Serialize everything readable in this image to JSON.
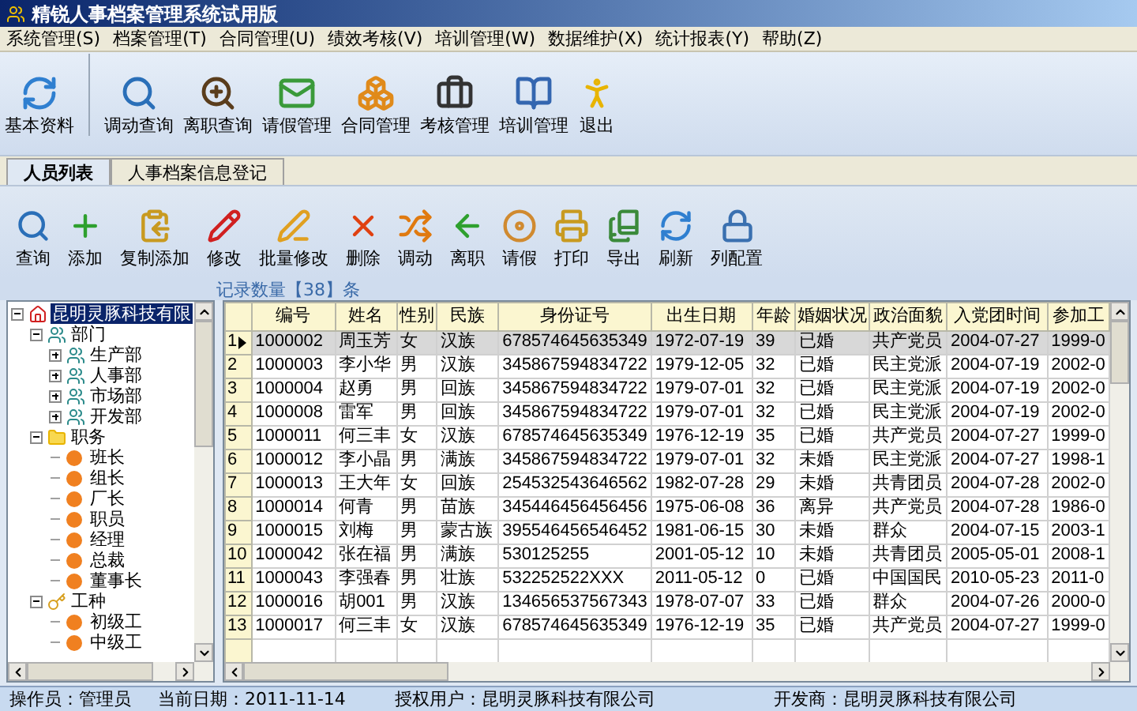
{
  "window": {
    "title": "精锐人事档案管理系统试用版"
  },
  "menu": [
    "系统管理(S)",
    "档案管理(T)",
    "合同管理(U)",
    "绩效考核(V)",
    "培训管理(W)",
    "数据维护(X)",
    "统计报表(Y)",
    "帮助(Z)"
  ],
  "main_toolbar": [
    {
      "label": "基本资料",
      "kind": "refresh"
    },
    {
      "label": "调动查询",
      "kind": "search"
    },
    {
      "label": "离职查询",
      "kind": "zoom"
    },
    {
      "label": "请假管理",
      "kind": "mail"
    },
    {
      "label": "合同管理",
      "kind": "boxes"
    },
    {
      "label": "考核管理",
      "kind": "case"
    },
    {
      "label": "培训管理",
      "kind": "books"
    },
    {
      "label": "退出",
      "kind": "exit"
    }
  ],
  "tabs": [
    {
      "label": "人员列表",
      "selected": true
    },
    {
      "label": "人事档案信息登记",
      "selected": false
    }
  ],
  "list_toolbar": [
    {
      "label": "查询",
      "kind": "search"
    },
    {
      "label": "添加",
      "kind": "plus"
    },
    {
      "label": "复制添加",
      "kind": "copy"
    },
    {
      "label": "修改",
      "kind": "pencil"
    },
    {
      "label": "批量修改",
      "kind": "pen"
    },
    {
      "label": "删除",
      "kind": "delete"
    },
    {
      "label": "调动",
      "kind": "move"
    },
    {
      "label": "离职",
      "kind": "back"
    },
    {
      "label": "请假",
      "kind": "disc"
    },
    {
      "label": "打印",
      "kind": "print"
    },
    {
      "label": "导出",
      "kind": "export"
    },
    {
      "label": "刷新",
      "kind": "refresh"
    },
    {
      "label": "列配置",
      "kind": "lock"
    }
  ],
  "record_count": "记录数量【38】条",
  "tree": [
    {
      "label": "昆明灵豚科技有限",
      "kind": "company",
      "expanded": true,
      "selected": true,
      "children": [
        {
          "label": "部门",
          "kind": "group",
          "expanded": true,
          "selected": false,
          "children": [
            {
              "label": "生产部",
              "kind": "dept",
              "expanded": false,
              "selected": false
            },
            {
              "label": "人事部",
              "kind": "dept",
              "expanded": false,
              "selected": false
            },
            {
              "label": "市场部",
              "kind": "dept",
              "expanded": false,
              "selected": false
            },
            {
              "label": "开发部",
              "kind": "dept",
              "expanded": false,
              "selected": false
            }
          ]
        },
        {
          "label": "职务",
          "kind": "folder",
          "expanded": true,
          "selected": false,
          "children": [
            {
              "label": "班长",
              "kind": "item",
              "selected": false
            },
            {
              "label": "组长",
              "kind": "item",
              "selected": false
            },
            {
              "label": "厂长",
              "kind": "item",
              "selected": false
            },
            {
              "label": "职员",
              "kind": "item",
              "selected": false
            },
            {
              "label": "经理",
              "kind": "item",
              "selected": false
            },
            {
              "label": "总裁",
              "kind": "item",
              "selected": false
            },
            {
              "label": "董事长",
              "kind": "item",
              "selected": false
            }
          ]
        },
        {
          "label": "工种",
          "kind": "key",
          "expanded": true,
          "selected": false,
          "children": [
            {
              "label": "初级工",
              "kind": "item",
              "selected": false
            },
            {
              "label": "中级工",
              "kind": "item",
              "selected": false
            }
          ]
        }
      ]
    }
  ],
  "table": {
    "columns": [
      "编号",
      "姓名",
      "性别",
      "民族",
      "身份证号",
      "出生日期",
      "年龄",
      "婚姻状况",
      "政治面貌",
      "入党团时间",
      "参加工"
    ],
    "rows": [
      {
        "n": "1",
        "selected": true,
        "cells": [
          "1000002",
          "周玉芳",
          "女",
          "汉族",
          "678574645635349",
          "1972-07-19",
          "39",
          "已婚",
          "共产党员",
          "2004-07-27",
          "1999-0"
        ]
      },
      {
        "n": "2",
        "selected": false,
        "cells": [
          "1000003",
          "李小华",
          "男",
          "汉族",
          "345867594834722",
          "1979-12-05",
          "32",
          "已婚",
          "民主党派",
          "2004-07-19",
          "2002-0"
        ]
      },
      {
        "n": "3",
        "selected": false,
        "cells": [
          "1000004",
          "赵勇",
          "男",
          "回族",
          "345867594834722",
          "1979-07-01",
          "32",
          "已婚",
          "民主党派",
          "2004-07-19",
          "2002-0"
        ]
      },
      {
        "n": "4",
        "selected": false,
        "cells": [
          "1000008",
          "雷军",
          "男",
          "回族",
          "345867594834722",
          "1979-07-01",
          "32",
          "已婚",
          "民主党派",
          "2004-07-19",
          "2002-0"
        ]
      },
      {
        "n": "5",
        "selected": false,
        "cells": [
          "1000011",
          "何三丰",
          "女",
          "汉族",
          "678574645635349",
          "1976-12-19",
          "35",
          "已婚",
          "共产党员",
          "2004-07-27",
          "1999-0"
        ]
      },
      {
        "n": "6",
        "selected": false,
        "cells": [
          "1000012",
          "李小晶",
          "男",
          "满族",
          "345867594834722",
          "1979-07-01",
          "32",
          "未婚",
          "民主党派",
          "2004-07-27",
          "1998-1"
        ]
      },
      {
        "n": "7",
        "selected": false,
        "cells": [
          "1000013",
          "王大年",
          "女",
          "回族",
          "254532543646562",
          "1982-07-28",
          "29",
          "未婚",
          "共青团员",
          "2004-07-28",
          "2002-0"
        ]
      },
      {
        "n": "8",
        "selected": false,
        "cells": [
          "1000014",
          "何青",
          "男",
          "苗族",
          "345446456456456",
          "1975-06-08",
          "36",
          "离异",
          "共产党员",
          "2004-07-28",
          "1986-0"
        ]
      },
      {
        "n": "9",
        "selected": false,
        "cells": [
          "1000015",
          "刘梅",
          "男",
          "蒙古族",
          "395546456546452",
          "1981-06-15",
          "30",
          "未婚",
          "群众",
          "2004-07-15",
          "2003-1"
        ]
      },
      {
        "n": "10",
        "selected": false,
        "cells": [
          "1000042",
          "张在福",
          "男",
          "满族",
          "530125255",
          "2001-05-12",
          "10",
          "未婚",
          "共青团员",
          "2005-05-01",
          "2008-1"
        ]
      },
      {
        "n": "11",
        "selected": false,
        "cells": [
          "1000043",
          "李强春",
          "男",
          "壮族",
          "532252522XXX",
          "2011-05-12",
          "0",
          "已婚",
          "中国国民",
          "2010-05-23",
          "2011-0"
        ]
      },
      {
        "n": "12",
        "selected": false,
        "cells": [
          "1000016",
          "胡001",
          "男",
          "汉族",
          "134656537567343",
          "1978-07-07",
          "33",
          "已婚",
          "群众",
          "2004-07-26",
          "2000-0"
        ]
      },
      {
        "n": "13",
        "selected": false,
        "cells": [
          "1000017",
          "何三丰",
          "女",
          "汉族",
          "678574645635349",
          "1976-12-19",
          "35",
          "已婚",
          "共产党员",
          "2004-07-27",
          "1999-0"
        ]
      }
    ]
  },
  "status_bar": {
    "operator": "操作员：管理员",
    "date": "当前日期：2011-11-14",
    "licensee": "授权用户：昆明灵豚科技有限公司",
    "developer": "开发商：昆明灵豚科技有限公司"
  }
}
